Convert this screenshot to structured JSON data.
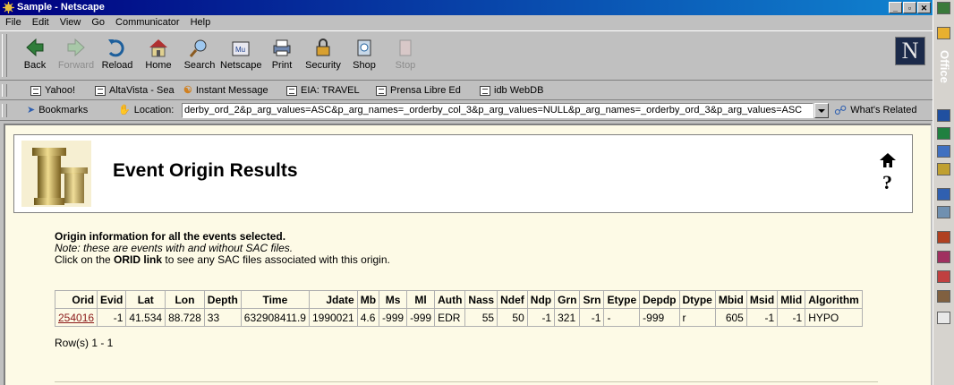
{
  "window": {
    "title": "Sample - Netscape"
  },
  "menu": [
    "File",
    "Edit",
    "View",
    "Go",
    "Communicator",
    "Help"
  ],
  "toolbar": {
    "buttons": [
      {
        "label": "Back",
        "icon": "back-arrow-icon"
      },
      {
        "label": "Forward",
        "icon": "forward-arrow-icon"
      },
      {
        "label": "Reload",
        "icon": "reload-icon"
      },
      {
        "label": "Home",
        "icon": "home-icon"
      },
      {
        "label": "Search",
        "icon": "search-icon"
      },
      {
        "label": "Netscape",
        "icon": "netscape-icon"
      },
      {
        "label": "Print",
        "icon": "print-icon"
      },
      {
        "label": "Security",
        "icon": "security-lock-icon"
      },
      {
        "label": "Shop",
        "icon": "shop-icon"
      },
      {
        "label": "Stop",
        "icon": "stop-icon"
      }
    ]
  },
  "personal": [
    "Yahoo!",
    "AltaVista - Sea",
    "Instant Message",
    "EIA: TRAVEL",
    "Prensa Libre Ed",
    "idb WebDB"
  ],
  "location": {
    "bookmarks_label": "Bookmarks",
    "location_label": "Location:",
    "url": "derby_ord_2&p_arg_values=ASC&p_arg_names=_orderby_col_3&p_arg_values=NULL&p_arg_names=_orderby_ord_3&p_arg_values=ASC",
    "related_label": "What's Related"
  },
  "page": {
    "title": "Event Origin Results",
    "help": "?",
    "info_heading": "Origin information for all the events selected.",
    "info_note": "Note: these are events with and without SAC files.",
    "info_click_pre": "Click on the ",
    "info_click_bold": "ORID link",
    "info_click_post": " to see any SAC files associated with this origin.",
    "rows_text": "Row(s) 1 - 1"
  },
  "table": {
    "headers": [
      "Orid",
      "Evid",
      "Lat",
      "Lon",
      "Depth",
      "Time",
      "Jdate",
      "Mb",
      "Ms",
      "Ml",
      "Auth",
      "Nass",
      "Ndef",
      "Ndp",
      "Grn",
      "Srn",
      "Etype",
      "Depdp",
      "Dtype",
      "Mbid",
      "Msid",
      "Mlid",
      "Algorithm"
    ],
    "rows": [
      [
        "254016",
        "-1",
        "41.534",
        "88.728",
        "33",
        "632908411.9",
        "1990021",
        "4.6",
        "-999",
        "-999",
        "EDR",
        "55",
        "50",
        "-1",
        "321",
        "-1",
        "-",
        "-999",
        "r",
        "605",
        "-1",
        "-1",
        "HYPO"
      ]
    ]
  },
  "office_bar": {
    "label": "Office"
  }
}
